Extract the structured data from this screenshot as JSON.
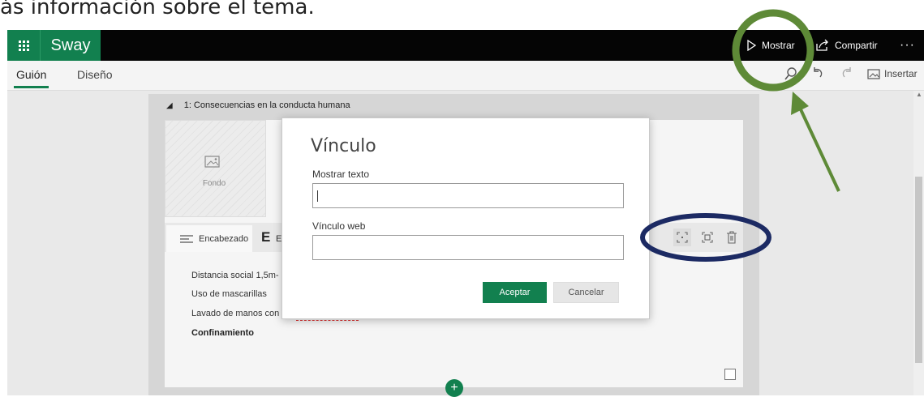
{
  "caption": "ás información sobre el tema.",
  "appbar": {
    "app_name": "Sway",
    "show_label": "Mostrar",
    "share_label": "Compartir",
    "more_label": "···"
  },
  "tabs": {
    "guion": "Guión",
    "diseno": "Diseño",
    "insert_label": "Insertar"
  },
  "card": {
    "title": "1: Consecuencias en la conducta humana",
    "background_label": "Fondo",
    "heading_tab": "Encabezado",
    "emphasis_letter": "E",
    "emphasis_small": "E",
    "lines": [
      "Distancia social 1,5m-",
      "Uso de mascarillas",
      "Lavado de manos con"
    ],
    "bold_line": "Confinamiento"
  },
  "dialog": {
    "title": "Vínculo",
    "text_label": "Mostrar texto",
    "web_label": "Vínculo web",
    "ok": "Aceptar",
    "cancel": "Cancelar"
  },
  "colors": {
    "accent": "#12804f",
    "annotation_green": "#5e8a37",
    "annotation_blue": "#1c2a63"
  }
}
